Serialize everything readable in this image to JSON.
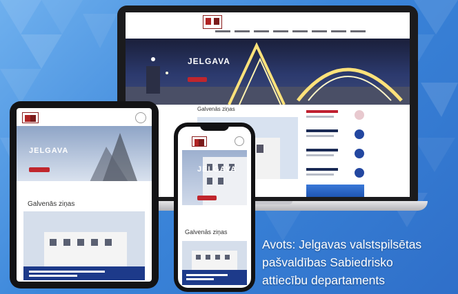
{
  "laptop": {
    "hero_city": "JELGAVA",
    "section_title": "Galvenās ziņas"
  },
  "tablet": {
    "hero_city": "JELGAVA",
    "section_title": "Galvenās ziņas"
  },
  "phone": {
    "hero_city": "JELGAVA",
    "section_title": "Galvenās ziņas"
  },
  "caption": {
    "line1": "Avots: Jelgavas valstspilsētas",
    "line2": "pašvaldības Sabiedrisko",
    "line3": "attiecību departaments"
  },
  "colors": {
    "background_blue": "#3b86da",
    "brand_red": "#c0262d",
    "accent_navy": "#2347a0"
  }
}
